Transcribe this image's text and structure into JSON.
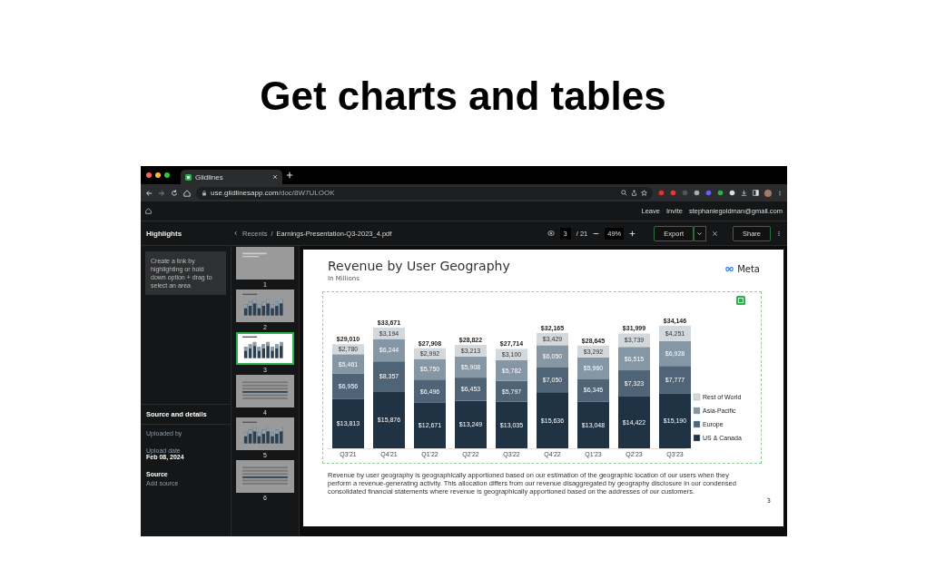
{
  "headline": "Get charts and tables",
  "browser": {
    "tab_title": "Glidlines",
    "url_host": "use.glidlinesapp.com",
    "url_path": "/doc/8W7ULOOK"
  },
  "app_header": {
    "links": [
      "Leave",
      "Invite"
    ],
    "account": "stephaniegoldman@gmail.com"
  },
  "sidebar": {
    "title": "Highlights",
    "hint": "Create a link by highlighting or hold down option + drag to select an area",
    "details_title": "Source and details",
    "items": [
      {
        "kind": "muted",
        "text": "Uploaded by"
      },
      {
        "kind": "muted",
        "text": "Upload date"
      },
      {
        "kind": "value",
        "text": "Feb 08, 2024"
      },
      {
        "kind": "heading",
        "text": "Source"
      },
      {
        "kind": "link",
        "text": "Add source"
      }
    ]
  },
  "toolbar": {
    "breadcrumb": [
      "Recents",
      "Earnings-Presentation-Q3-2023_4.pdf"
    ],
    "separator": "/",
    "page": "3",
    "page_total": "/ 21",
    "zoom": "49%",
    "export": "Export",
    "share": "Share"
  },
  "thumbnails": [
    {
      "label": "1",
      "kind": "text",
      "selected": false
    },
    {
      "label": "2",
      "kind": "chart",
      "selected": false
    },
    {
      "label": "3",
      "kind": "chart",
      "selected": true
    },
    {
      "label": "4",
      "kind": "table",
      "selected": false
    },
    {
      "label": "5",
      "kind": "chart",
      "selected": false
    },
    {
      "label": "6",
      "kind": "table",
      "selected": false
    }
  ],
  "slide": {
    "title": "Revenue by User Geography",
    "subtitle": "In Millions",
    "logo": "Meta",
    "chart_data": {
      "type": "bar",
      "stacked": true,
      "orientation": "vertical",
      "data_labels": true,
      "legend": true,
      "categories": [
        "Q3'21",
        "Q4'21",
        "Q1'22",
        "Q2'22",
        "Q3'22",
        "Q4'22",
        "Q1'23",
        "Q2'23",
        "Q3'23"
      ],
      "series": [
        {
          "name": "US & Canada",
          "color": "#1f3344",
          "values": [
            13813,
            15876,
            12671,
            13249,
            13035,
            15636,
            13048,
            14422,
            15190
          ],
          "value_labels": [
            "$13,813",
            "$15,876",
            "$12,671",
            "$13,249",
            "$13,035",
            "$15,636",
            "$13,048",
            "$14,422",
            "$15,190"
          ]
        },
        {
          "name": "Europe",
          "color": "#4f6577",
          "values": [
            6956,
            8357,
            6496,
            6453,
            5797,
            7050,
            6345,
            7323,
            7777
          ],
          "value_labels": [
            "$6,956",
            "$8,357",
            "$6,496",
            "$6,453",
            "$5,797",
            "$7,050",
            "$6,345",
            "$7,323",
            "$7,777"
          ]
        },
        {
          "name": "Asia-Pacific",
          "color": "#8596a4",
          "values": [
            5461,
            6244,
            5750,
            5908,
            5782,
            6050,
            5960,
            6515,
            6928
          ],
          "value_labels": [
            "$5,461",
            "$6,244",
            "$5,750",
            "$5,908",
            "$5,782",
            "$6,050",
            "$5,960",
            "$6,515",
            "$6,928"
          ]
        },
        {
          "name": "Rest of World",
          "color": "#d3d8dc",
          "values": [
            2780,
            3194,
            2992,
            3213,
            3100,
            3429,
            3292,
            3739,
            4251
          ],
          "value_labels": [
            "$2,780",
            "$3,194",
            "$2,992",
            "$3,213",
            "$3,100",
            "$3,429",
            "$3,292",
            "$3,739",
            "$4,251"
          ]
        }
      ],
      "annotations": [
        "$29,010",
        "$33,671",
        "$27,908",
        "$28,822",
        "$27,714",
        "$32,165",
        "$28,645",
        "$31,999",
        "$34,146"
      ]
    },
    "footnote": "Revenue by user geography is geographically apportioned based on our estimation of the geographic location of our users when they perform a revenue-generating activity. This allocation differs from our revenue disaggregated by geography disclosure in our condensed consolidated financial statements where revenue is geographically apportioned based on the addresses of our customers.",
    "page_number": "3"
  }
}
